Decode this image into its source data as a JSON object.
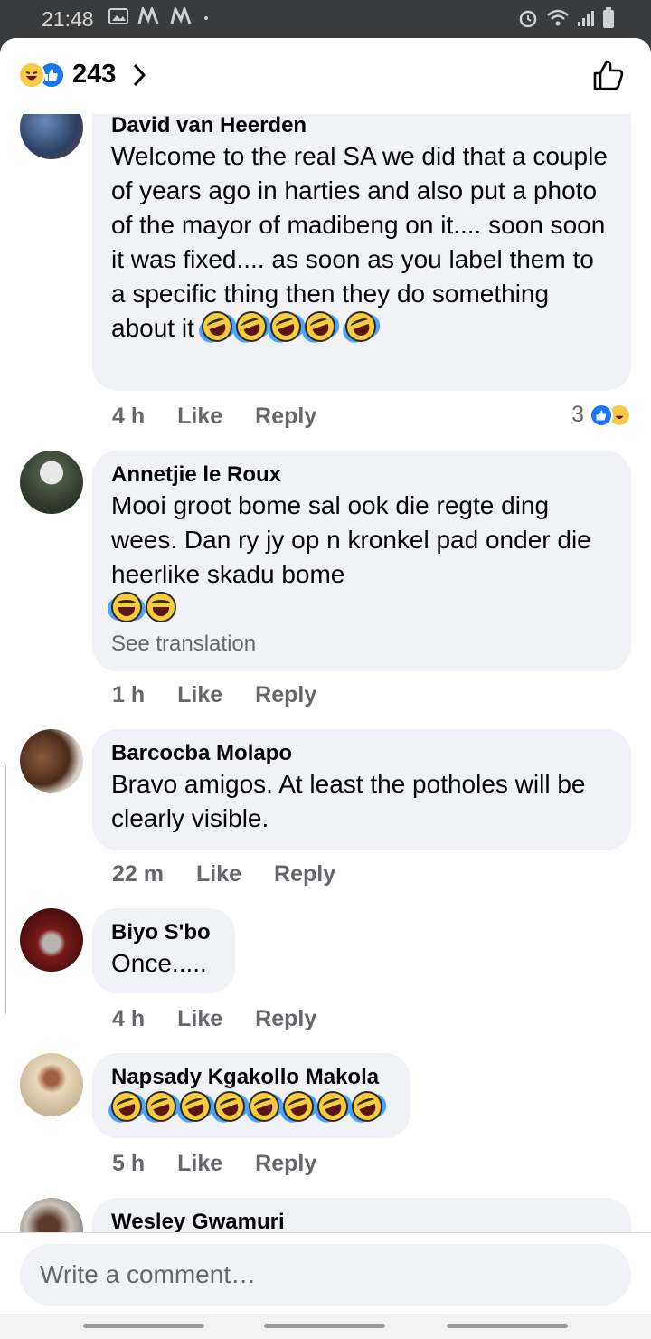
{
  "status_bar": {
    "time": "21:48"
  },
  "header": {
    "reaction_count": "243"
  },
  "comments": [
    {
      "author": "David van Heerden",
      "text": "Welcome to the real SA we did that a couple of years ago in harties and also put a photo of the mayor of madibeng on it.... soon soon it was fixed.... as soon as you label them to a specific thing then they do something about it",
      "time": "4 h",
      "like_label": "Like",
      "reply_label": "Reply",
      "reaction_count": "3"
    },
    {
      "author": "Annetjie le Roux",
      "text": "Mooi groot bome sal ook die regte ding wees.  Dan ry jy op n kronkel pad onder die heerlike skadu bome",
      "translation_link": "See translation",
      "time": "1 h",
      "like_label": "Like",
      "reply_label": "Reply"
    },
    {
      "author": "Barcocba Molapo",
      "text": "Bravo amigos. At least the potholes will be clearly visible.",
      "time": "22 m",
      "like_label": "Like",
      "reply_label": "Reply"
    },
    {
      "author": "Biyo S'bo",
      "text": "Once.....",
      "time": "4 h",
      "like_label": "Like",
      "reply_label": "Reply"
    },
    {
      "author": "Napsady Kgakollo Makola",
      "time": "5 h",
      "like_label": "Like",
      "reply_label": "Reply"
    },
    {
      "author": "Wesley Gwamuri"
    }
  ],
  "composer": {
    "placeholder": "Write a comment…"
  },
  "colors": {
    "accent": "#1877f2",
    "bubble": "#f0f2f5",
    "muted": "#65676b"
  }
}
